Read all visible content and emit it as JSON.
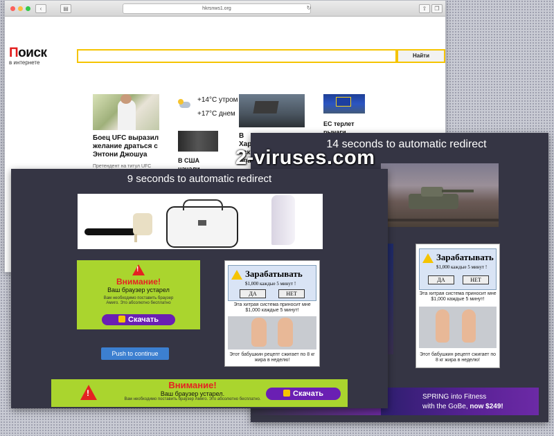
{
  "browser": {
    "url": "hkrsnws1.org",
    "logo": {
      "first_letter": "П",
      "rest": "оиск",
      "sub": "в интернете"
    },
    "search": {
      "button_label": "Найти",
      "placeholder": ""
    },
    "news": [
      {
        "title": "Боец UFC выразил желание драться с Энтони Джошуа",
        "meta": "Претендент на титул UFC"
      },
      {
        "weather_morning": "+14°C утром",
        "weather_day": "+17°C днем"
      },
      {
        "title": "В Харьк... оск... бра...",
        "meta": ""
      },
      {
        "title": "ЕС терлет рычаги",
        "meta": ""
      },
      {
        "title": "В США начали",
        "meta": ""
      }
    ]
  },
  "overlay_front": {
    "title": "9 seconds to automatic redirect",
    "push_button": "Push to continue",
    "warn_ad": {
      "title": "Внимание!",
      "subtitle": "Ваш браузер устарел",
      "body": "Вам необходимо поставить браузер Амиго. Это абсолютно бесплатно",
      "button": "Скачать"
    },
    "scam_ad": {
      "title": "Зарабатывать",
      "subtitle": "$1,000 каждые 5 минут !",
      "yes": "ДА",
      "no": "НЕТ",
      "text1": "Эта хитрая система приносит мне $1,000 каждые 5 минут!",
      "text2": "Этот бабушкин рецепт сжигает по 8 кг жира в неделю!"
    },
    "bottom_ad": {
      "title": "Внимание!",
      "subtitle": "Ваш браузер устарел.",
      "body": "Вам необходимо поставить браузер Амиго. Это абсолютно бесплатно.",
      "button": "Скачать"
    }
  },
  "overlay_back": {
    "title": "14 seconds to automatic redirect",
    "scam_ad": {
      "title": "Зарабатывать",
      "subtitle": "$1,000 каждые 5 минут !",
      "yes": "ДА",
      "no": "НЕТ",
      "text1": "Эта хитрая система приносит мне $1,000 каждые 5 минут!",
      "text2": "Этот бабушкин рецепт сжигает по 8 кг жира в неделю!"
    },
    "fitness_ad": {
      "line1": "SPRING into Fitness",
      "line2_prefix": "with the GoBe, ",
      "line2_bold": "now $249!"
    }
  },
  "watermark": "2-viruses.com",
  "colors": {
    "overlay_bg": "#353544",
    "warn_green": "#aad52e",
    "download_purple": "#6a1fb3",
    "push_blue": "#3c7fd0",
    "search_yellow": "#f5c400"
  }
}
